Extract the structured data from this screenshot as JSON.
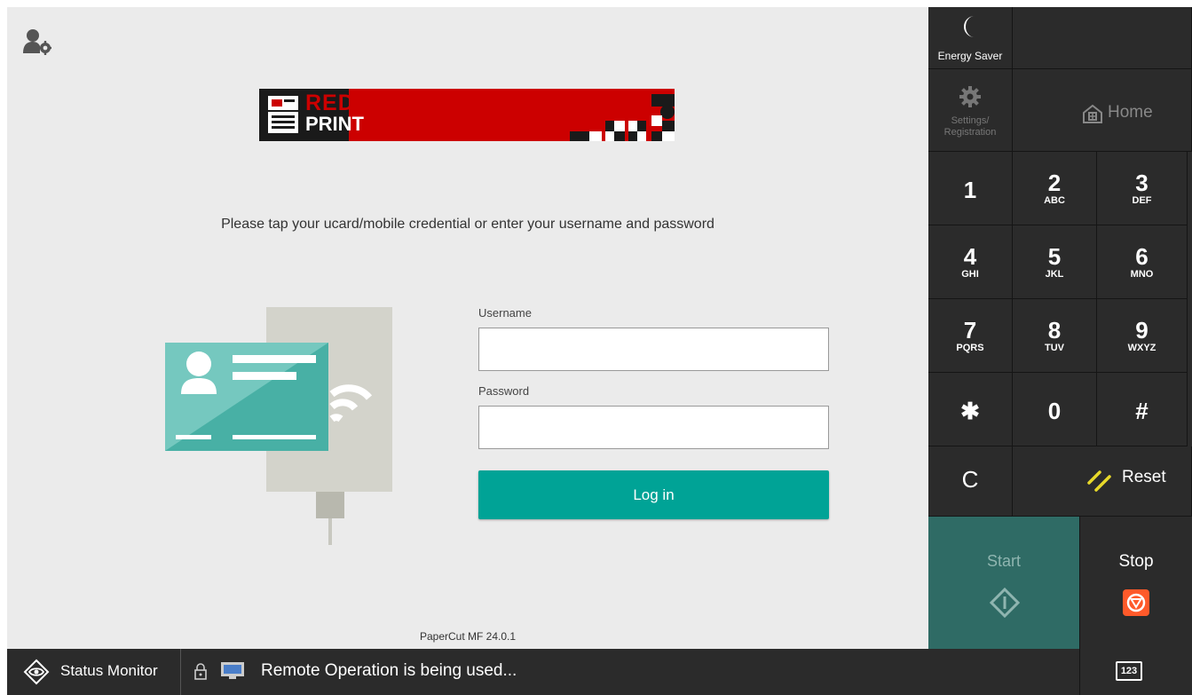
{
  "main": {
    "instruction": "Please tap your ucard/mobile credential or enter your username and password",
    "version": "PaperCut MF 24.0.1",
    "banner": {
      "logo_word1": "RED",
      "logo_word2": "PRINT"
    }
  },
  "form": {
    "username_label": "Username",
    "username_value": "",
    "password_label": "Password",
    "password_value": "",
    "login_button": "Log in"
  },
  "panel": {
    "energy_saver": "Energy Saver",
    "settings_line1": "Settings/",
    "settings_line2": "Registration",
    "home": "Home",
    "keys": [
      {
        "digit": "1",
        "letters": ""
      },
      {
        "digit": "2",
        "letters": "ABC"
      },
      {
        "digit": "3",
        "letters": "DEF"
      },
      {
        "digit": "4",
        "letters": "GHI"
      },
      {
        "digit": "5",
        "letters": "JKL"
      },
      {
        "digit": "6",
        "letters": "MNO"
      },
      {
        "digit": "7",
        "letters": "PQRS"
      },
      {
        "digit": "8",
        "letters": "TUV"
      },
      {
        "digit": "9",
        "letters": "WXYZ"
      },
      {
        "digit": "✱",
        "letters": ""
      },
      {
        "digit": "0",
        "letters": ""
      },
      {
        "digit": "#",
        "letters": ""
      }
    ],
    "clear": "C",
    "reset": "Reset",
    "start": "Start",
    "stop": "Stop"
  },
  "statusbar": {
    "status_monitor": "Status Monitor",
    "remote_message": "Remote Operation is being used...",
    "keyboard_label": "123"
  },
  "colors": {
    "accent": "#00a396",
    "banner_red": "#cc0000",
    "panel_bg": "#2b2b2b",
    "start_bg": "#2f6b65",
    "stop_icon": "#ff5a2a",
    "reset_icon": "#e8d92a"
  }
}
